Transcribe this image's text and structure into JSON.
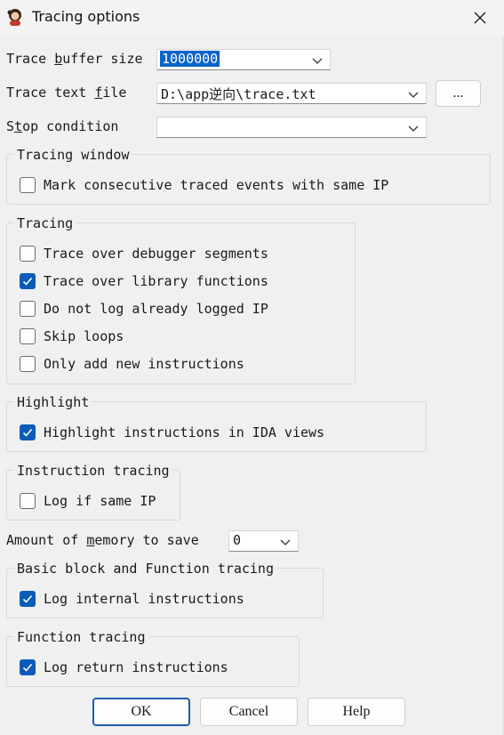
{
  "window": {
    "title": "Tracing options",
    "app_icon": "avatar-icon",
    "close_icon": "close-icon"
  },
  "trace_buffer_size": {
    "label_pre": "Trace ",
    "label_u": "b",
    "label_post": "uffer size",
    "value": "1000000"
  },
  "trace_text_file": {
    "label_pre": "Trace text ",
    "label_u": "f",
    "label_post": "ile",
    "value": "D:\\app逆向\\trace.txt",
    "browse_label": "..."
  },
  "stop_condition": {
    "label_pre": "S",
    "label_u": "t",
    "label_post": "op condition",
    "value": ""
  },
  "tracing_window": {
    "title": "Tracing window",
    "items": [
      {
        "label": "Mark consecutive traced events with same IP",
        "checked": false
      }
    ]
  },
  "tracing": {
    "title": "Tracing",
    "items": [
      {
        "label": "Trace over debugger segments",
        "checked": false
      },
      {
        "label": "Trace over library functions",
        "checked": true
      },
      {
        "label": "Do not log already logged IP",
        "checked": false
      },
      {
        "label": "Skip loops",
        "checked": false
      },
      {
        "label": "Only add new instructions",
        "checked": false
      }
    ]
  },
  "highlight": {
    "title": "Highlight",
    "items": [
      {
        "label": "Highlight instructions in IDA views",
        "checked": true
      }
    ]
  },
  "instruction_tracing": {
    "title": "Instruction tracing",
    "items": [
      {
        "label": "Log if same IP",
        "checked": false
      }
    ]
  },
  "memory": {
    "label_pre": "Amount of ",
    "label_u": "m",
    "label_post": "emory to save",
    "value": "0"
  },
  "basic_block_tracing": {
    "title": "Basic block and Function tracing",
    "items": [
      {
        "label": "Log internal instructions",
        "checked": true
      }
    ]
  },
  "function_tracing": {
    "title": "Function tracing",
    "items": [
      {
        "label": "Log return instructions",
        "checked": true
      }
    ]
  },
  "buttons": {
    "ok": "OK",
    "cancel": "Cancel",
    "help": "Help"
  },
  "colors": {
    "accent": "#0a5cb8",
    "background": "#f0f0f0"
  }
}
